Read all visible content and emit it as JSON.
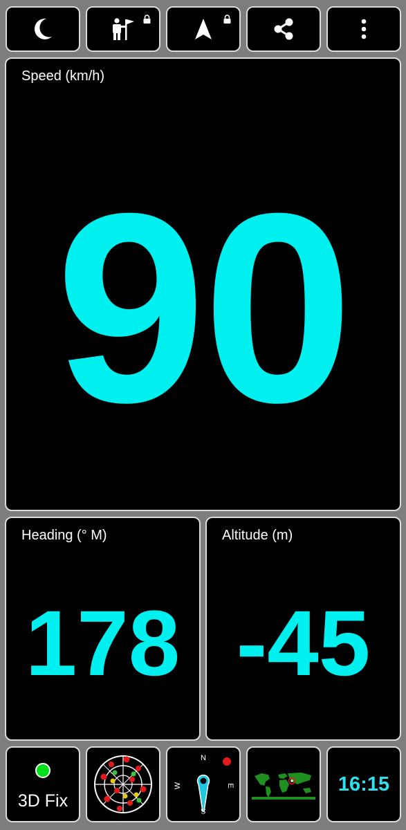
{
  "toolbar": {
    "buttons": [
      {
        "name": "night-mode",
        "icon": "moon-icon",
        "locked": false
      },
      {
        "name": "tour-guide",
        "icon": "tour-guide-icon",
        "locked": true
      },
      {
        "name": "navigation",
        "icon": "navigation-arrow-icon",
        "locked": true
      },
      {
        "name": "share",
        "icon": "share-icon",
        "locked": false
      },
      {
        "name": "more",
        "icon": "more-vertical-icon",
        "locked": false
      }
    ]
  },
  "speed": {
    "label": "Speed (km/h)",
    "value": "90"
  },
  "heading": {
    "label": "Heading (° M)",
    "value": "178"
  },
  "altitude": {
    "label": "Altitude (m)",
    "value": "-45"
  },
  "bottom_bar": {
    "fix_status": "3D Fix",
    "compass": {
      "north": "N",
      "east": "E",
      "south": "S",
      "west": "W"
    },
    "time": "16:15"
  },
  "colors": {
    "accent": "#00f0f0",
    "background": "#000000",
    "frame": "#7d7d7d",
    "border": "#dcdcdc",
    "fix_ok": "#00e01a"
  }
}
